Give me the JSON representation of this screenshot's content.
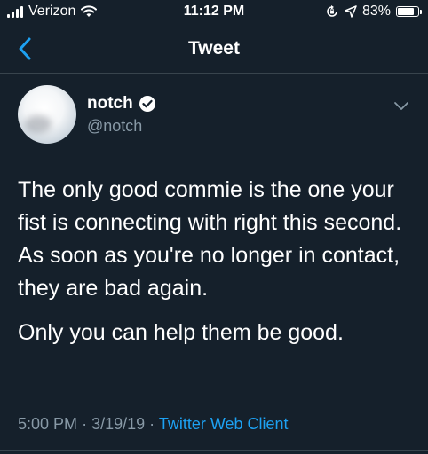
{
  "status_bar": {
    "carrier": "Verizon",
    "time": "11:12 PM",
    "battery": "83%",
    "battery_level": 0.83
  },
  "nav": {
    "title": "Tweet",
    "back_icon": "chevron-left-icon"
  },
  "tweet": {
    "display_name": "notch",
    "handle": "@notch",
    "verified": true,
    "lines": [
      "The only good commie is the one your fist is connecting with right this second.",
      "As soon as you're no longer in contact, they are bad again.",
      "Only you can help them be good."
    ],
    "time": "5:00 PM",
    "date": "3/19/19",
    "separator": "·",
    "client": "Twitter Web Client"
  },
  "colors": {
    "background": "#15202b",
    "accent": "#1da1f2",
    "secondary_text": "#8899a6",
    "divider": "#38444d"
  }
}
